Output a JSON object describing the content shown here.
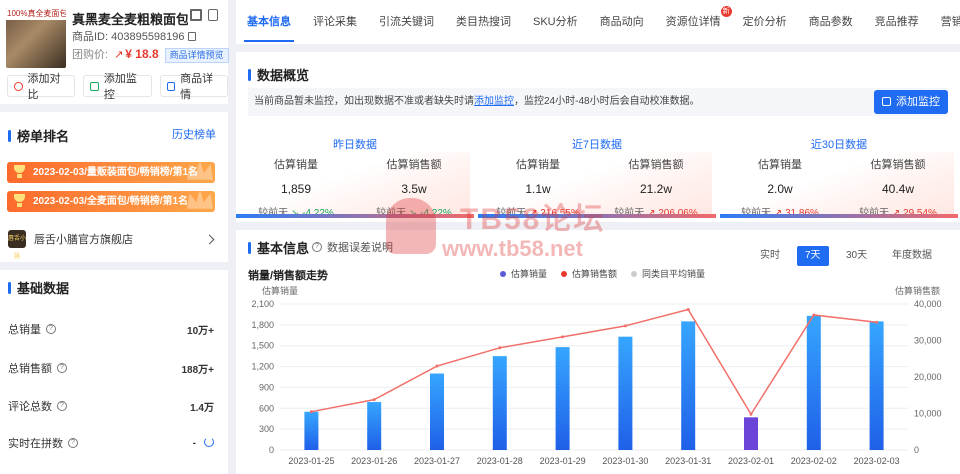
{
  "product": {
    "thumb_tag": "100%真全麦面包",
    "title": "真黑麦全麦粗粮面包...",
    "id_label": "商品ID: 403895598196",
    "group_label": "团购价:",
    "price": "¥ 18.8",
    "preview_label": "商品详情预览",
    "buttons": [
      "添加对比",
      "添加监控",
      "商品详情"
    ]
  },
  "ranking": {
    "title": "榜单排名",
    "history_link": "历史榜单",
    "items": [
      "2023-02-03/量贩装面包/畅销榜/第1名",
      "2023-02-03/全麦面包/畅销榜/第1名"
    ],
    "shop_logo": "唇舌小膳",
    "shop_name": "唇舌小膳官方旗舰店"
  },
  "basic": {
    "title": "基础数据",
    "rows": [
      {
        "label": "总销量",
        "value": "10万+"
      },
      {
        "label": "总销售额",
        "value": "188万+"
      },
      {
        "label": "评论总数",
        "value": "1.4万"
      },
      {
        "label": "实时在拼数",
        "value": "-"
      }
    ]
  },
  "tabs": [
    "基本信息",
    "评论采集",
    "引流关键词",
    "类目热搜词",
    "SKU分析",
    "商品动向",
    "资源位详情",
    "定价分析",
    "商品参数",
    "竞品推荐",
    "营销分析"
  ],
  "tab_new_badge": "新",
  "overview": {
    "title": "数据概览",
    "notice_pre": "当前商品暂未监控，如出现数据不准或者缺失时请",
    "notice_link": "添加监控",
    "notice_post": "，监控24小时-48小时后会自动校准数据。",
    "add_button": "添加监控",
    "periods": [
      {
        "label": "昨日数据",
        "metrics": [
          {
            "name": "估算销量",
            "value": "1,859",
            "cmp": "较前天",
            "delta": "-4.22%",
            "dir": "down"
          },
          {
            "name": "估算销售额",
            "value": "3.5w",
            "cmp": "较前天",
            "delta": "-4.22%",
            "dir": "down"
          }
        ]
      },
      {
        "label": "近7日数据",
        "metrics": [
          {
            "name": "估算销量",
            "value": "1.1w",
            "cmp": "较前天",
            "delta": "216.55%",
            "dir": "up"
          },
          {
            "name": "估算销售额",
            "value": "21.2w",
            "cmp": "较前天",
            "delta": "206.06%",
            "dir": "up"
          }
        ]
      },
      {
        "label": "近30日数据",
        "metrics": [
          {
            "name": "估算销量",
            "value": "2.0w",
            "cmp": "较前天",
            "delta": "31.86%",
            "dir": "up"
          },
          {
            "name": "估算销售额",
            "value": "40.4w",
            "cmp": "较前天",
            "delta": "29.54%",
            "dir": "up"
          }
        ]
      }
    ]
  },
  "basic_info": {
    "title": "基本信息",
    "help": "数据误差说明",
    "ranges": [
      "实时",
      "7天",
      "30天",
      "年度数据"
    ],
    "active_range": "7天",
    "chart_title": "销量/销售额走势"
  },
  "watermark": {
    "line1": "TB58论坛",
    "line2": "www.tb58.net"
  },
  "colors": {
    "accent": "#1f6bf2",
    "up": "#e8392f",
    "down": "#19a85a",
    "line": "#f2706a",
    "highlight_bar": "#6a45d8"
  },
  "chart_data": {
    "type": "bar",
    "x": [
      "2023-01-25",
      "2023-01-26",
      "2023-01-27",
      "2023-01-28",
      "2023-01-29",
      "2023-01-30",
      "2023-01-31",
      "2023-02-01",
      "2023-02-02",
      "2023-02-03"
    ],
    "left_axis_label": "估算销量",
    "right_axis_label": "估算销售额",
    "left_ticks": [
      "0",
      "300",
      "600",
      "900",
      "1,200",
      "1,500",
      "1,800",
      "2,100"
    ],
    "right_ticks": [
      "0",
      "10,000",
      "20,000",
      "30,000",
      "40,000"
    ],
    "ylim_left": [
      0,
      2100
    ],
    "ylim_right": [
      0,
      40000
    ],
    "series": [
      {
        "name": "估算销量",
        "type": "bar",
        "values": [
          550,
          690,
          1100,
          1350,
          1480,
          1630,
          1850,
          470,
          1930,
          1850
        ]
      },
      {
        "name": "估算销售额",
        "type": "line",
        "values": [
          10500,
          13800,
          23000,
          28000,
          31000,
          34000,
          38500,
          9800,
          37000,
          35000
        ]
      },
      {
        "name": "同类目平均销量",
        "type": "line",
        "values": []
      }
    ],
    "highlight_index": 7
  }
}
